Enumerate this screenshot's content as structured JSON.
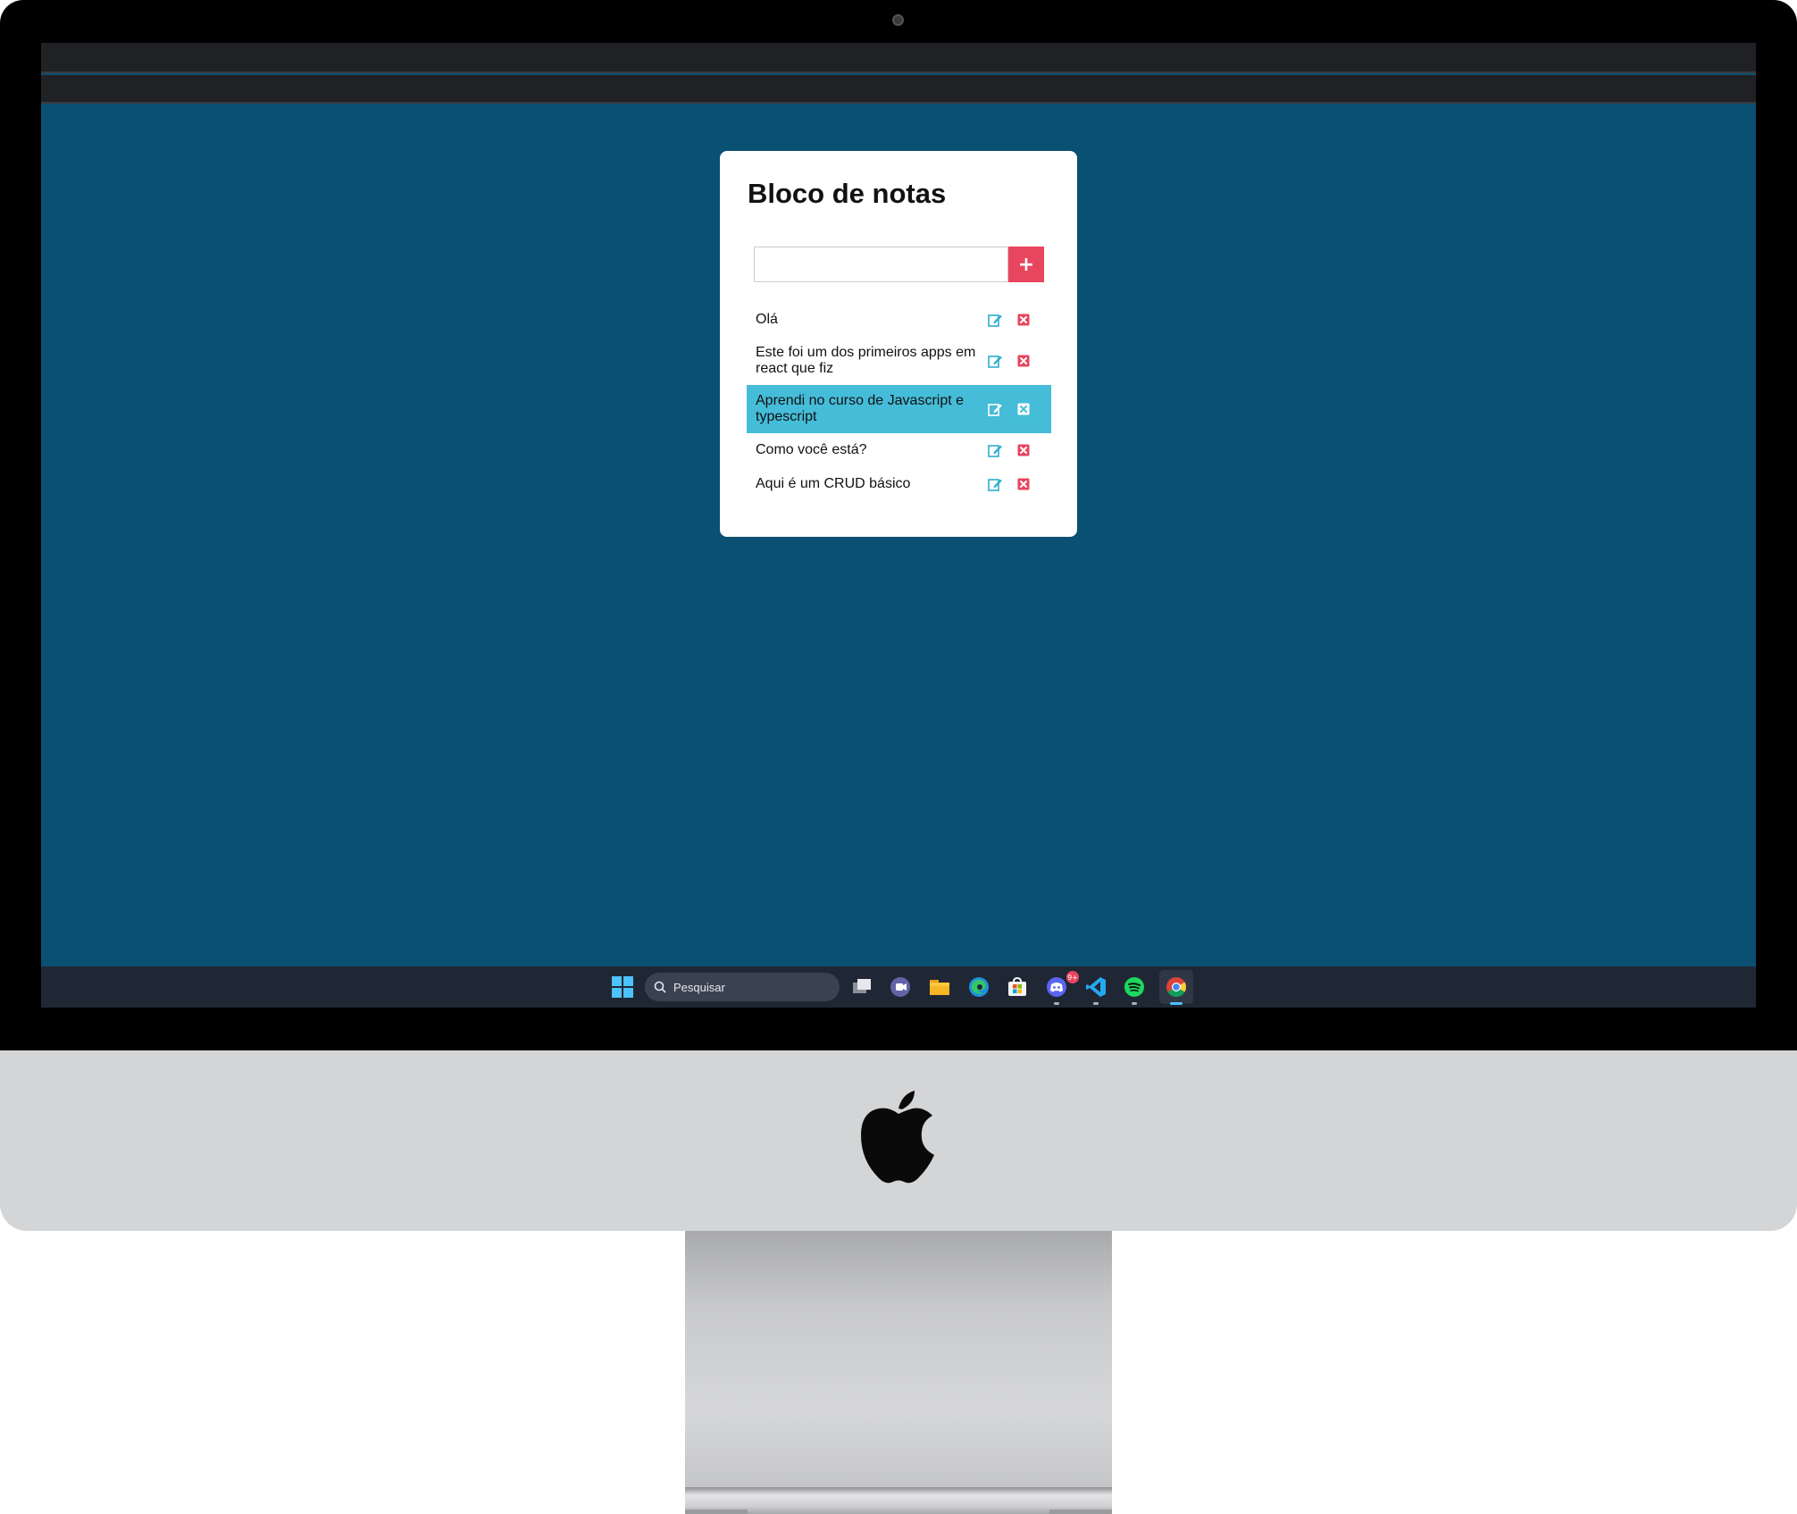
{
  "app": {
    "title": "Bloco de notas",
    "add_button_label": "+",
    "input_value": "",
    "input_placeholder": ""
  },
  "notes": [
    {
      "text": "Olá",
      "active": false
    },
    {
      "text": "Este foi um dos primeiros apps em react que fiz",
      "active": false
    },
    {
      "text": "Aprendi no curso de Javascript e typescript",
      "active": true
    },
    {
      "text": "Como você está?",
      "active": false
    },
    {
      "text": "Aqui é um CRUD básico",
      "active": false
    }
  ],
  "taskbar": {
    "search_label": "Pesquisar",
    "discord_badge": "9+",
    "apps": [
      "windows-start-icon",
      "task-view-icon",
      "teams-chat-icon",
      "file-explorer-icon",
      "edge-icon",
      "microsoft-store-icon",
      "discord-icon",
      "vscode-icon",
      "spotify-icon",
      "chrome-icon"
    ]
  },
  "colors": {
    "page_bg": "#0a5072",
    "accent_add": "#e8455f",
    "active_note_bg": "#45bcd8",
    "edit_icon": "#2aaed0",
    "delete_icon": "#e8455f"
  }
}
